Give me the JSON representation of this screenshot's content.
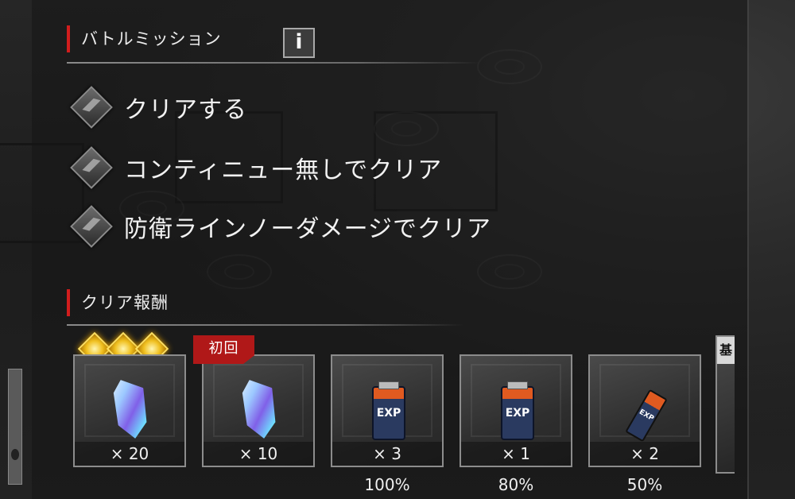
{
  "battle_mission": {
    "title": "バトルミッション",
    "info_label": "i",
    "missions": [
      {
        "text": "クリアする",
        "icon": "mission-diamond-icon"
      },
      {
        "text": "コンティニュー無しでクリア",
        "icon": "mission-diamond-icon"
      },
      {
        "text": "防衛ラインノーダメージでクリア",
        "icon": "mission-diamond-icon"
      }
    ]
  },
  "clear_rewards": {
    "title": "クリア報酬",
    "first_clear_tag": "初回",
    "partial_tag": "基",
    "stars_earned": 3,
    "items": [
      {
        "item": "crystal",
        "count": "× 20",
        "rate": ""
      },
      {
        "item": "crystal",
        "count": "× 10",
        "rate": ""
      },
      {
        "item": "exp-battery",
        "count": "× 3",
        "rate": "100%"
      },
      {
        "item": "exp-battery",
        "count": "× 1",
        "rate": "80%"
      },
      {
        "item": "exp-small-battery",
        "count": "× 2",
        "rate": "50%"
      }
    ]
  },
  "colors": {
    "accent_red": "#d21d1d",
    "star_gold": "#f0c020",
    "tag_red": "#b01818"
  }
}
